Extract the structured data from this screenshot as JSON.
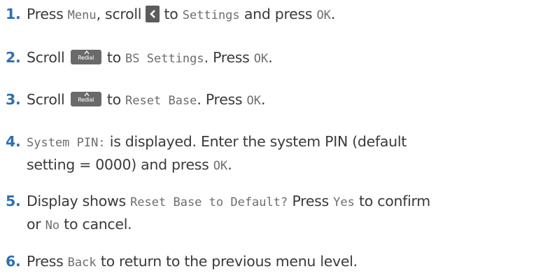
{
  "steps": [
    {
      "num": "1.",
      "parts": [
        "Press ",
        "Menu",
        ", scroll ",
        " to ",
        "Settings",
        " and press ",
        "OK",
        "."
      ]
    },
    {
      "num": "2.",
      "parts": [
        "Scroll ",
        " to ",
        "BS Settings",
        ". Press ",
        "OK",
        "."
      ]
    },
    {
      "num": "3.",
      "parts": [
        "Scroll ",
        " to ",
        "Reset Base",
        ". Press ",
        "OK",
        "."
      ]
    },
    {
      "num": "4.",
      "parts": [
        "System PIN:",
        " is displayed. Enter the system PIN (default",
        "setting = 0000) and press ",
        "OK",
        "."
      ]
    },
    {
      "num": "5.",
      "parts": [
        "Display shows ",
        "Reset Base to Default?",
        " Press ",
        "Yes",
        " to confirm",
        "or ",
        "No",
        " to cancel."
      ]
    },
    {
      "num": "6.",
      "parts": [
        "Press ",
        "Back",
        " to return to the previous menu level."
      ]
    }
  ],
  "keys": {
    "left_key_icon": "chevron-left-icon",
    "redial_key_label": "Redial",
    "redial_key_icon": "up-arrow-icon"
  },
  "colors": {
    "step_number": "#2a6fb7",
    "body_text": "#3a3a3a",
    "display_text": "#6d6d6d",
    "key_background": "#5c5c5c"
  }
}
